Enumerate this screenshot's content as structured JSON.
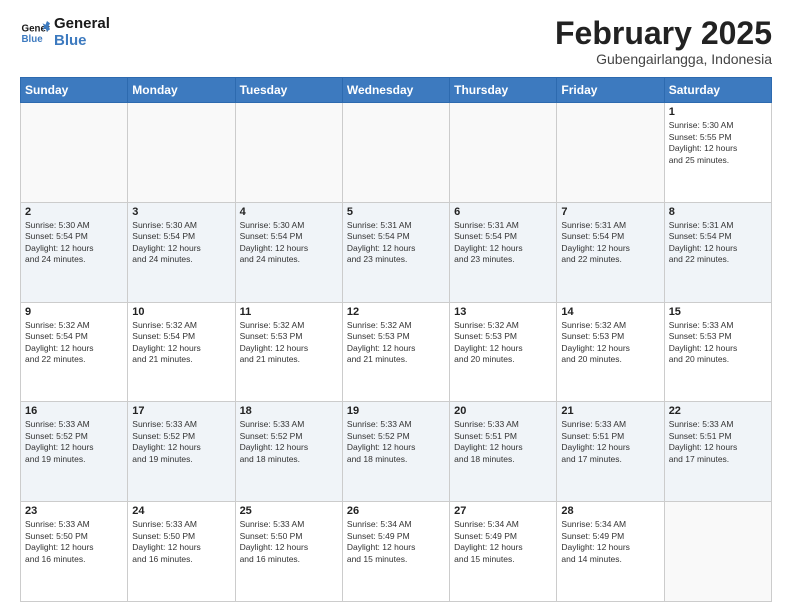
{
  "logo": {
    "line1": "General",
    "line2": "Blue"
  },
  "title": "February 2025",
  "subtitle": "Gubengairlangga, Indonesia",
  "weekdays": [
    "Sunday",
    "Monday",
    "Tuesday",
    "Wednesday",
    "Thursday",
    "Friday",
    "Saturday"
  ],
  "weeks": [
    [
      {
        "day": "",
        "info": ""
      },
      {
        "day": "",
        "info": ""
      },
      {
        "day": "",
        "info": ""
      },
      {
        "day": "",
        "info": ""
      },
      {
        "day": "",
        "info": ""
      },
      {
        "day": "",
        "info": ""
      },
      {
        "day": "1",
        "info": "Sunrise: 5:30 AM\nSunset: 5:55 PM\nDaylight: 12 hours\nand 25 minutes."
      }
    ],
    [
      {
        "day": "2",
        "info": "Sunrise: 5:30 AM\nSunset: 5:54 PM\nDaylight: 12 hours\nand 24 minutes."
      },
      {
        "day": "3",
        "info": "Sunrise: 5:30 AM\nSunset: 5:54 PM\nDaylight: 12 hours\nand 24 minutes."
      },
      {
        "day": "4",
        "info": "Sunrise: 5:30 AM\nSunset: 5:54 PM\nDaylight: 12 hours\nand 24 minutes."
      },
      {
        "day": "5",
        "info": "Sunrise: 5:31 AM\nSunset: 5:54 PM\nDaylight: 12 hours\nand 23 minutes."
      },
      {
        "day": "6",
        "info": "Sunrise: 5:31 AM\nSunset: 5:54 PM\nDaylight: 12 hours\nand 23 minutes."
      },
      {
        "day": "7",
        "info": "Sunrise: 5:31 AM\nSunset: 5:54 PM\nDaylight: 12 hours\nand 22 minutes."
      },
      {
        "day": "8",
        "info": "Sunrise: 5:31 AM\nSunset: 5:54 PM\nDaylight: 12 hours\nand 22 minutes."
      }
    ],
    [
      {
        "day": "9",
        "info": "Sunrise: 5:32 AM\nSunset: 5:54 PM\nDaylight: 12 hours\nand 22 minutes."
      },
      {
        "day": "10",
        "info": "Sunrise: 5:32 AM\nSunset: 5:54 PM\nDaylight: 12 hours\nand 21 minutes."
      },
      {
        "day": "11",
        "info": "Sunrise: 5:32 AM\nSunset: 5:53 PM\nDaylight: 12 hours\nand 21 minutes."
      },
      {
        "day": "12",
        "info": "Sunrise: 5:32 AM\nSunset: 5:53 PM\nDaylight: 12 hours\nand 21 minutes."
      },
      {
        "day": "13",
        "info": "Sunrise: 5:32 AM\nSunset: 5:53 PM\nDaylight: 12 hours\nand 20 minutes."
      },
      {
        "day": "14",
        "info": "Sunrise: 5:32 AM\nSunset: 5:53 PM\nDaylight: 12 hours\nand 20 minutes."
      },
      {
        "day": "15",
        "info": "Sunrise: 5:33 AM\nSunset: 5:53 PM\nDaylight: 12 hours\nand 20 minutes."
      }
    ],
    [
      {
        "day": "16",
        "info": "Sunrise: 5:33 AM\nSunset: 5:52 PM\nDaylight: 12 hours\nand 19 minutes."
      },
      {
        "day": "17",
        "info": "Sunrise: 5:33 AM\nSunset: 5:52 PM\nDaylight: 12 hours\nand 19 minutes."
      },
      {
        "day": "18",
        "info": "Sunrise: 5:33 AM\nSunset: 5:52 PM\nDaylight: 12 hours\nand 18 minutes."
      },
      {
        "day": "19",
        "info": "Sunrise: 5:33 AM\nSunset: 5:52 PM\nDaylight: 12 hours\nand 18 minutes."
      },
      {
        "day": "20",
        "info": "Sunrise: 5:33 AM\nSunset: 5:51 PM\nDaylight: 12 hours\nand 18 minutes."
      },
      {
        "day": "21",
        "info": "Sunrise: 5:33 AM\nSunset: 5:51 PM\nDaylight: 12 hours\nand 17 minutes."
      },
      {
        "day": "22",
        "info": "Sunrise: 5:33 AM\nSunset: 5:51 PM\nDaylight: 12 hours\nand 17 minutes."
      }
    ],
    [
      {
        "day": "23",
        "info": "Sunrise: 5:33 AM\nSunset: 5:50 PM\nDaylight: 12 hours\nand 16 minutes."
      },
      {
        "day": "24",
        "info": "Sunrise: 5:33 AM\nSunset: 5:50 PM\nDaylight: 12 hours\nand 16 minutes."
      },
      {
        "day": "25",
        "info": "Sunrise: 5:33 AM\nSunset: 5:50 PM\nDaylight: 12 hours\nand 16 minutes."
      },
      {
        "day": "26",
        "info": "Sunrise: 5:34 AM\nSunset: 5:49 PM\nDaylight: 12 hours\nand 15 minutes."
      },
      {
        "day": "27",
        "info": "Sunrise: 5:34 AM\nSunset: 5:49 PM\nDaylight: 12 hours\nand 15 minutes."
      },
      {
        "day": "28",
        "info": "Sunrise: 5:34 AM\nSunset: 5:49 PM\nDaylight: 12 hours\nand 14 minutes."
      },
      {
        "day": "",
        "info": ""
      }
    ]
  ]
}
